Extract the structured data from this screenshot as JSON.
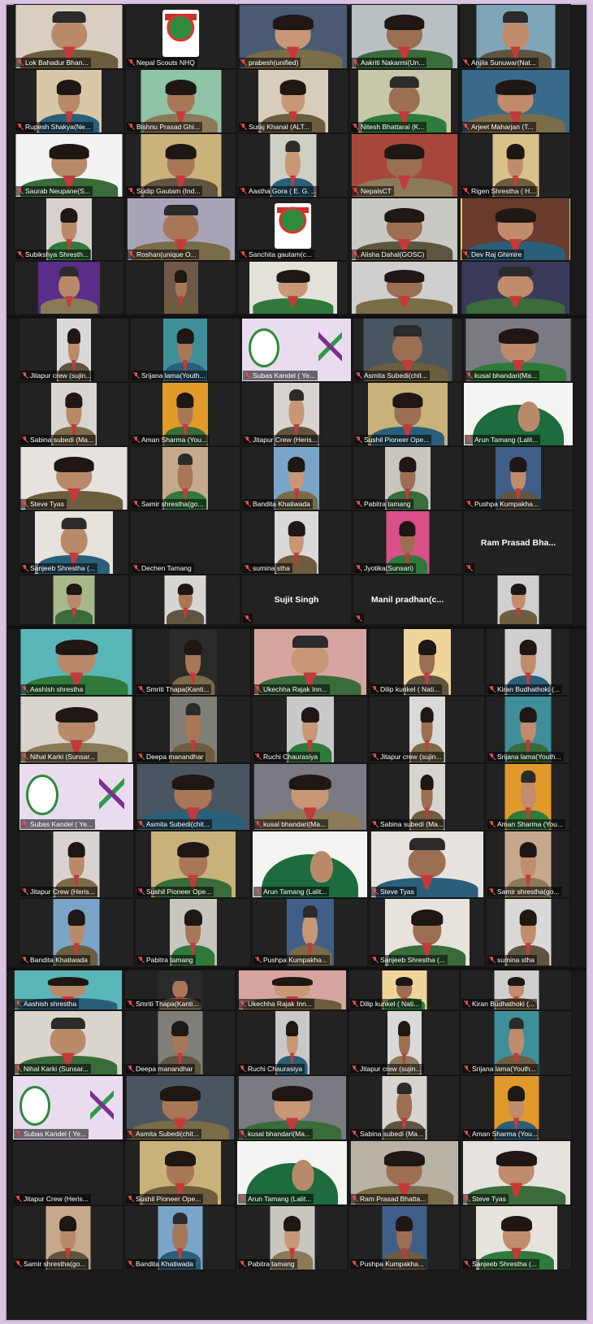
{
  "colors": {
    "background": "#d9c4e3",
    "grid": "#1a1a1a",
    "active_border": "#e8d14f",
    "muted_mic": "#e84b4b"
  },
  "screens": [
    {
      "rows": [
        [
          {
            "name": "Lok Bahadur Bhan...",
            "video": true,
            "bg": "#d8cfc2"
          },
          {
            "name": "Nepal Scouts NHQ",
            "logo": true
          },
          {
            "name": "prabesh(unified)",
            "video": true,
            "bg": "#4a5a73"
          },
          {
            "name": "Aakriti Nakarmi(Un...",
            "video": true,
            "bg": "#b8c0c4"
          },
          {
            "name": "Anjila Sunuwar(Nat...",
            "video": true,
            "bg": "#7fa6b8"
          }
        ],
        [
          {
            "name": "Rupesh Shakya(Ne...",
            "video": true,
            "bg": "#d9c8a8"
          },
          {
            "name": "Bishnu Prasad Ghi...",
            "video": true,
            "bg": "#8fc4a6"
          },
          {
            "name": "Suraj Khanal (ALT...",
            "video": true,
            "bg": "#d8cdbb"
          },
          {
            "name": "Nitesh Bhattarai (K...",
            "video": true,
            "bg": "#c7c8a9"
          },
          {
            "name": "Arjeet Maharjan (T...",
            "video": true,
            "bg": "#3a6a8a"
          }
        ],
        [
          {
            "name": "Saurab Neupane(S...",
            "video": true,
            "bg": "#f3f3f3"
          },
          {
            "name": "Sudip Gautam (Ind...",
            "video": true,
            "bg": "#c9b37a"
          },
          {
            "name": "Aastha Gora ( E. G. ...",
            "video": true,
            "bg": "#cfcfc4"
          },
          {
            "name": "NepalsCT",
            "video": true,
            "bg": "#a7473c"
          },
          {
            "name": "Rigen Shrestha ( H...",
            "video": true,
            "bg": "#d9c18a"
          }
        ],
        [
          {
            "name": "Subikshya Shresth...",
            "video": true,
            "bg": "#d7d0cc"
          },
          {
            "name": "Roshan(unique O...",
            "video": true,
            "bg": "#a8a4b8"
          },
          {
            "name": "Sanchita gautam(c...",
            "logo": true
          },
          {
            "name": "Alisha Dahal(GOSC)",
            "video": true,
            "bg": "#c9c9c3"
          },
          {
            "name": "Dev Raj Ghimire",
            "video": true,
            "bg": "#6a3a2c",
            "active": true
          }
        ],
        [
          {
            "name": "",
            "video": true,
            "bg": "#5a2d8a"
          },
          {
            "name": "",
            "video": true,
            "bg": "#6f5845"
          },
          {
            "name": "",
            "video": true,
            "bg": "#e4e0da"
          },
          {
            "name": "",
            "video": true,
            "bg": "#cfcfcf"
          },
          {
            "name": "",
            "video": true,
            "bg": "#3a3a5a"
          }
        ]
      ]
    },
    {
      "rows": [
        [
          {
            "name": "Jitapur crew (sujin...",
            "video": true,
            "bg": "#d9d9d9"
          },
          {
            "name": "Srijana lama(Youth...",
            "video": true,
            "bg": "#3e8f9a"
          },
          {
            "name": "Subas Kandel ( Ye...",
            "youth": true
          },
          {
            "name": "Asmita Subedi(chit...",
            "video": true,
            "bg": "#4a5562"
          },
          {
            "name": "kusal bhandari(Ma...",
            "video": true,
            "bg": "#7a7a82"
          }
        ],
        [
          {
            "name": "Sabina subedi (Ma...",
            "video": true,
            "bg": "#d8d4d0"
          },
          {
            "name": "Aman Sharma (You...",
            "video": true,
            "bg": "#e19a2a"
          },
          {
            "name": "Jitapur Crew (Heris...",
            "video": true,
            "bg": "#d8d3d0"
          },
          {
            "name": "Sushil Pioneer Ope...",
            "video": true,
            "bg": "#c9b27a"
          },
          {
            "name": "Arun Tamang (Lalit...",
            "green": true
          }
        ],
        [
          {
            "name": "Steve Tyas",
            "video": true,
            "bg": "#e6e3de"
          },
          {
            "name": "Samir shrestha(go...",
            "video": true,
            "bg": "#c6a98c"
          },
          {
            "name": "Bandita Khatiwada",
            "video": true,
            "bg": "#7aa5c8"
          },
          {
            "name": "Pabitra tamang",
            "video": true,
            "bg": "#c9c5bf"
          },
          {
            "name": "Pushpa Kumpakha...",
            "video": true,
            "bg": "#3f5f88"
          }
        ],
        [
          {
            "name": "Sanjeeb Shrestha (...",
            "video": true,
            "bg": "#e7e2dc"
          },
          {
            "name": "Dechen Tamang",
            "off": true
          },
          {
            "name": "sumina stha",
            "video": true,
            "bg": "#d9d9d9"
          },
          {
            "name": "Jyotika(Sunsari)",
            "video": true,
            "bg": "#d9508a"
          },
          {
            "name": "",
            "big": "Ram Prasad Bha..."
          }
        ],
        [
          {
            "name": "",
            "video": true,
            "bg": "#a7b88a"
          },
          {
            "name": "",
            "video": true,
            "bg": "#d8d6d3"
          },
          {
            "name": "",
            "big": "Sujit Singh"
          },
          {
            "name": "",
            "big": "Manil  pradhan(c..."
          },
          {
            "name": "",
            "video": true,
            "bg": "#d0d0d0"
          }
        ]
      ]
    },
    {
      "rows": [
        [
          {
            "name": "Aashish shrestha",
            "video": true,
            "bg": "#5ab7b8"
          },
          {
            "name": "Smriti Thapa(Kanti...",
            "video": true,
            "bg": "#2a2a2a"
          },
          {
            "name": "Ukechha Rajak Inn...",
            "video": true,
            "bg": "#d6a5a0"
          },
          {
            "name": "Dilip kunkel ( Nati...",
            "video": true,
            "bg": "#f0d59a"
          },
          {
            "name": "Kiran Budhathoki (...",
            "video": true,
            "bg": "#cfcfcf"
          }
        ],
        [
          {
            "name": "Nihal Karki (Sunsar...",
            "video": true,
            "bg": "#d9d5cc"
          },
          {
            "name": "Deepa manandhar",
            "video": true,
            "bg": "#7f7e78"
          },
          {
            "name": "Ruchi Chaurasiya",
            "video": true,
            "bg": "#c9c9c9"
          },
          {
            "name": "Jitapur crew (sujin...",
            "video": true,
            "bg": "#d9d9d9"
          },
          {
            "name": "Srijana lama(Youth...",
            "video": true,
            "bg": "#3e8f9a"
          }
        ],
        [
          {
            "name": "Subas Kandel ( Ye...",
            "youth": true
          },
          {
            "name": "Asmita Subedi(chit...",
            "video": true,
            "bg": "#4a5562"
          },
          {
            "name": "kusal bhandari(Ma...",
            "video": true,
            "bg": "#7a7a82"
          },
          {
            "name": "Sabina subedi (Ma...",
            "video": true,
            "bg": "#d8d4d0"
          },
          {
            "name": "Aman Sharma (You...",
            "video": true,
            "bg": "#e19a2a"
          }
        ],
        [
          {
            "name": "Jitapur Crew (Heris...",
            "video": true,
            "bg": "#d8d3d0"
          },
          {
            "name": "Sushil Pioneer Ope...",
            "video": true,
            "bg": "#c9b27a"
          },
          {
            "name": "Arun Tamang (Lalit...",
            "green": true
          },
          {
            "name": "Steve Tyas",
            "video": true,
            "bg": "#e6e3de"
          },
          {
            "name": "Samir shrestha(go...",
            "video": true,
            "bg": "#c6a98c"
          }
        ],
        [
          {
            "name": "Bandita Khatiwada",
            "video": true,
            "bg": "#7aa5c8"
          },
          {
            "name": "Pabitra tamang",
            "video": true,
            "bg": "#c9c5bf"
          },
          {
            "name": "Pushpa Kumpakha...",
            "video": true,
            "bg": "#3f5f88"
          },
          {
            "name": "Sanjeeb Shrestha (...",
            "video": true,
            "bg": "#e7e2dc"
          },
          {
            "name": "sumina stha",
            "video": true,
            "bg": "#d9d9d9"
          }
        ]
      ]
    },
    {
      "rows": [
        [
          {
            "name": "Aashish shrestha",
            "video": true,
            "bg": "#5ab7b8"
          },
          {
            "name": "Smriti Thapa(Kanti...",
            "video": true,
            "bg": "#2a2a2a"
          },
          {
            "name": "Ukechha Rajak Inn...",
            "video": true,
            "bg": "#d6a5a0"
          },
          {
            "name": "Dilip kunkel ( Nati...",
            "video": true,
            "bg": "#f0d59a"
          },
          {
            "name": "Kiran Budhathoki (...",
            "video": true,
            "bg": "#cfcfcf"
          }
        ],
        [
          {
            "name": "Nihal Karki (Sunsar...",
            "video": true,
            "bg": "#d9d5cc"
          },
          {
            "name": "Deepa manandhar",
            "video": true,
            "bg": "#7f7e78"
          },
          {
            "name": "Ruchi Chaurasiya",
            "video": true,
            "bg": "#c9c9c9"
          },
          {
            "name": "Jitapur crew (sujin...",
            "video": true,
            "bg": "#d9d9d9"
          },
          {
            "name": "Srijana lama(Youth...",
            "video": true,
            "bg": "#3e8f9a"
          }
        ],
        [
          {
            "name": "Subas Kandel ( Ye...",
            "youth": true
          },
          {
            "name": "Asmita Subedi(chit...",
            "video": true,
            "bg": "#4a5562"
          },
          {
            "name": "kusal bhandari(Ma...",
            "video": true,
            "bg": "#7a7a82"
          },
          {
            "name": "Sabina subedi (Ma...",
            "video": true,
            "bg": "#d8d4d0"
          },
          {
            "name": "Aman Sharma (You...",
            "video": true,
            "bg": "#e19a2a"
          }
        ],
        [
          {
            "name": "Jitapur Crew (Heris...",
            "off": true
          },
          {
            "name": "Sushil Pioneer Ope...",
            "video": true,
            "bg": "#c9b27a"
          },
          {
            "name": "Arun Tamang (Lalit...",
            "green": true
          },
          {
            "name": "Ram Prasad Bhatta...",
            "video": true,
            "bg": "#b9b3a6"
          },
          {
            "name": "Steve Tyas",
            "video": true,
            "bg": "#e6e3de"
          }
        ],
        [
          {
            "name": "Samir shrestha(go...",
            "video": true,
            "bg": "#c6a98c"
          },
          {
            "name": "Bandita Khatiwada",
            "video": true,
            "bg": "#7aa5c8"
          },
          {
            "name": "Pabitra tamang",
            "video": true,
            "bg": "#c9c5bf"
          },
          {
            "name": "Pushpa Kumpakha...",
            "video": true,
            "bg": "#3f5f88"
          },
          {
            "name": "Sanjeeb Shrestha (...",
            "video": true,
            "bg": "#e7e2dc"
          }
        ]
      ]
    }
  ]
}
